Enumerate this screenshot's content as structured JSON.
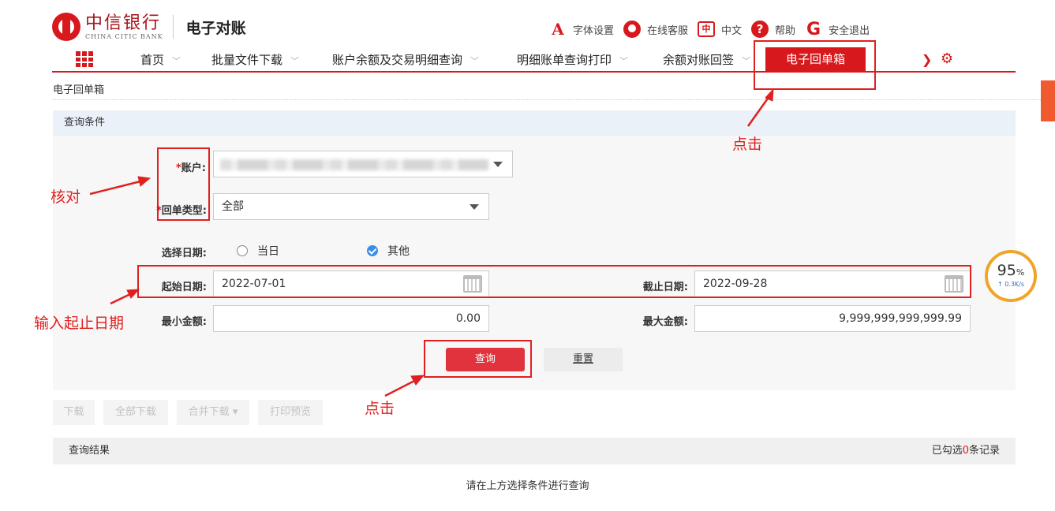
{
  "header": {
    "logo_cn": "中信银行",
    "logo_en": "CHINA CITIC BANK",
    "app_title": "电子对账",
    "top_links": [
      {
        "icon": "font-size-icon",
        "label": "字体设置"
      },
      {
        "icon": "customer-service-icon",
        "label": "在线客服"
      },
      {
        "icon": "language-icon",
        "label": "中文"
      },
      {
        "icon": "help-icon",
        "label": "帮助"
      },
      {
        "icon": "logout-icon",
        "label": "安全退出"
      }
    ]
  },
  "nav": {
    "items": [
      "首页",
      "批量文件下载",
      "账户余额及交易明细查询",
      "明细账单查询打印",
      "余额对账回签"
    ],
    "active": "电子回单箱"
  },
  "breadcrumb": "电子回单箱",
  "query": {
    "title": "查询条件",
    "account_label": "账户:",
    "receipt_type_label": "回单类型:",
    "receipt_type_value": "全部",
    "date_select_label": "选择日期:",
    "date_options": [
      "当日",
      "其他"
    ],
    "date_selected": "其他",
    "start_date_label": "起始日期:",
    "start_date": "2022-07-01",
    "end_date_label": "截止日期:",
    "end_date": "2022-09-28",
    "min_amount_label": "最小金额:",
    "min_amount": "0.00",
    "max_amount_label": "最大金额:",
    "max_amount": "9,999,999,999,999.99",
    "search_button": "查询",
    "reset_button": "重置"
  },
  "toolbar": {
    "download": "下载",
    "download_all": "全部下载",
    "merge_download": "合并下载",
    "print_preview": "打印预览"
  },
  "results": {
    "title": "查询结果",
    "selected_prefix": "已勾选",
    "selected_count": "0",
    "selected_suffix": "条记录",
    "empty_message": "请在上方选择条件进行查询"
  },
  "annotations": {
    "click_top": "点击",
    "verify": "核对",
    "enter_dates": "输入起止日期",
    "click_bottom": "点击"
  },
  "speed_widget": {
    "percent": "95",
    "unit": "%",
    "rate": "0.3K/s"
  },
  "colors": {
    "brand": "#d7191d",
    "annotation": "#e0201f",
    "primary_button": "#e1333e"
  }
}
